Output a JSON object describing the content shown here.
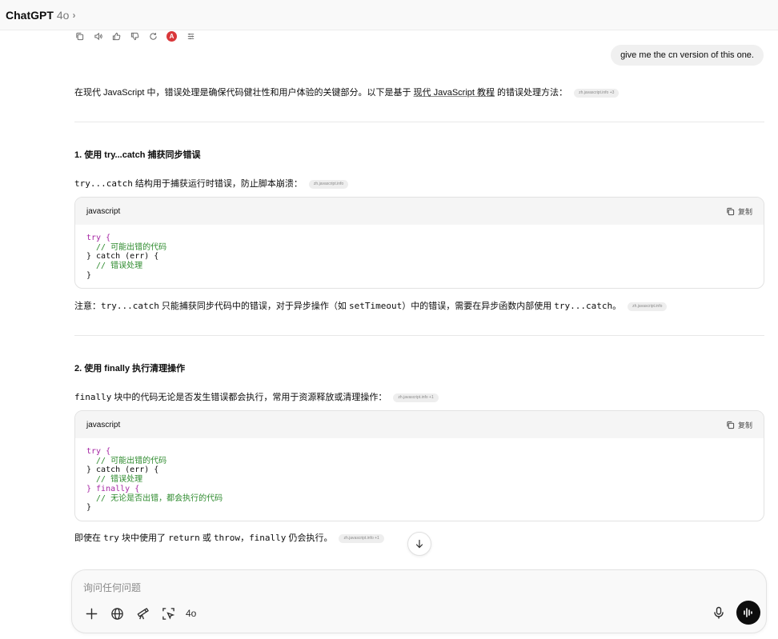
{
  "header": {
    "app_name": "ChatGPT",
    "model": "4o"
  },
  "icons": {
    "copy": "copy-icon",
    "read_aloud": "speaker-icon",
    "thumbs_up": "thumbs-up-icon",
    "thumbs_down": "thumbs-down-icon",
    "regenerate": "refresh-icon",
    "extension": "extension-icon",
    "more": "more-icon"
  },
  "extension_badge": "A",
  "user_message": "give me the cn version of this one.",
  "intro": {
    "text_before": "在现代 JavaScript 中，错误处理是确保代码健壮性和用户体验的关键部分。以下是基于 ",
    "link": "现代 JavaScript 教程",
    "text_after": " 的错误处理方法：",
    "citation": "zh.javascript.info +3"
  },
  "section1": {
    "heading": "1. 使用 try...catch 捕获同步错误",
    "desc_code": "try...catch",
    "desc": " 结构用于捕获运行时错误，防止脚本崩溃：",
    "citation": "zh.javascript.info",
    "code": {
      "language": "javascript",
      "copy_label": "复制",
      "lines": [
        "try {",
        "  // 可能出错的代码",
        "} catch (err) {",
        "  // 错误处理",
        "}"
      ]
    },
    "note_prefix": "注意：",
    "note_code1": "try...catch",
    "note_mid1": " 只能捕获同步代码中的错误，对于异步操作（如 ",
    "note_code2": "setTimeout",
    "note_mid2": "）中的错误，需要在异步函数内部使用 ",
    "note_code3": "try...catch",
    "note_end": "。",
    "note_citation": "zh.javascript.info"
  },
  "section2": {
    "heading": "2. 使用 finally 执行清理操作",
    "desc_code": "finally",
    "desc": " 块中的代码无论是否发生错误都会执行，常用于资源释放或清理操作：",
    "citation": "zh.javascript.info +1",
    "code": {
      "language": "javascript",
      "copy_label": "复制",
      "lines": [
        "try {",
        "  // 可能出错的代码",
        "} catch (err) {",
        "  // 错误处理",
        "} finally {",
        "  // 无论是否出错，都会执行的代码",
        "}"
      ]
    },
    "note_prefix": "即使在 ",
    "note_code1": "try",
    "note_mid1": " 块中使用了 ",
    "note_code2": "return",
    "note_mid2": " 或 ",
    "note_code3": "throw",
    "note_mid3": "，",
    "note_code4": "finally",
    "note_end": " 仍会执行。",
    "note_citation": "zh.javascript.info +1"
  },
  "composer": {
    "placeholder": "询问任何问题",
    "model_label": "4o"
  }
}
